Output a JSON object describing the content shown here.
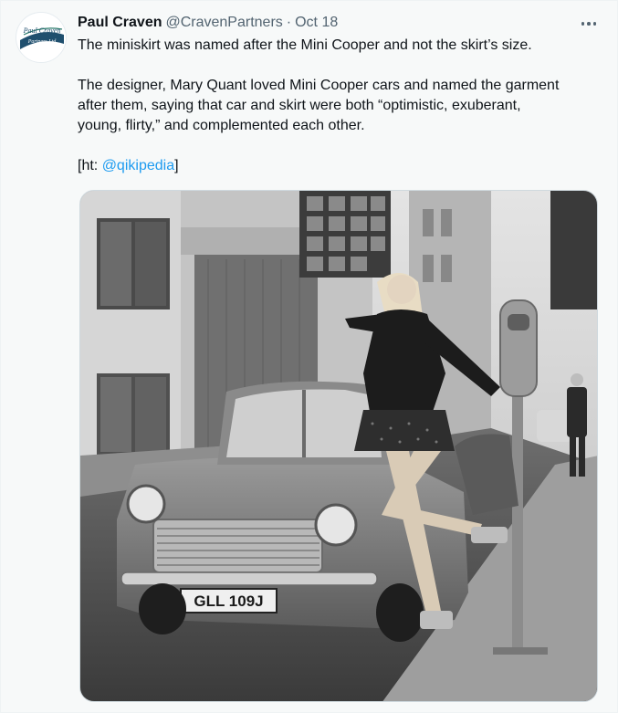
{
  "tweet": {
    "author_name": "Paul Craven",
    "author_handle": "@CravenPartners",
    "separator": "·",
    "date": "Oct 18",
    "avatar_text_line1": "Paul Craven",
    "avatar_text_line2": "Partners Ltd",
    "text_line1": "The miniskirt was named after the Mini Cooper and not the skirt’s size.",
    "text_para2_line1": "The designer, Mary Quant loved Mini Cooper cars and named the garment",
    "text_para2_line2": "after them, saying that car and skirt were both “optimistic, exuberant,",
    "text_para2_line3": "young, flirty,” and complemented each other.",
    "credit_prefix": "[ht: ",
    "credit_link": "@qikipedia",
    "credit_suffix": "]",
    "more_icon": "more-horizontal-icon"
  },
  "media": {
    "license_plate": "GLL 109J",
    "description_icon": "photo"
  },
  "colors": {
    "link": "#1d9bf0",
    "secondary_text": "#536471",
    "background": "#f7f9f9"
  }
}
